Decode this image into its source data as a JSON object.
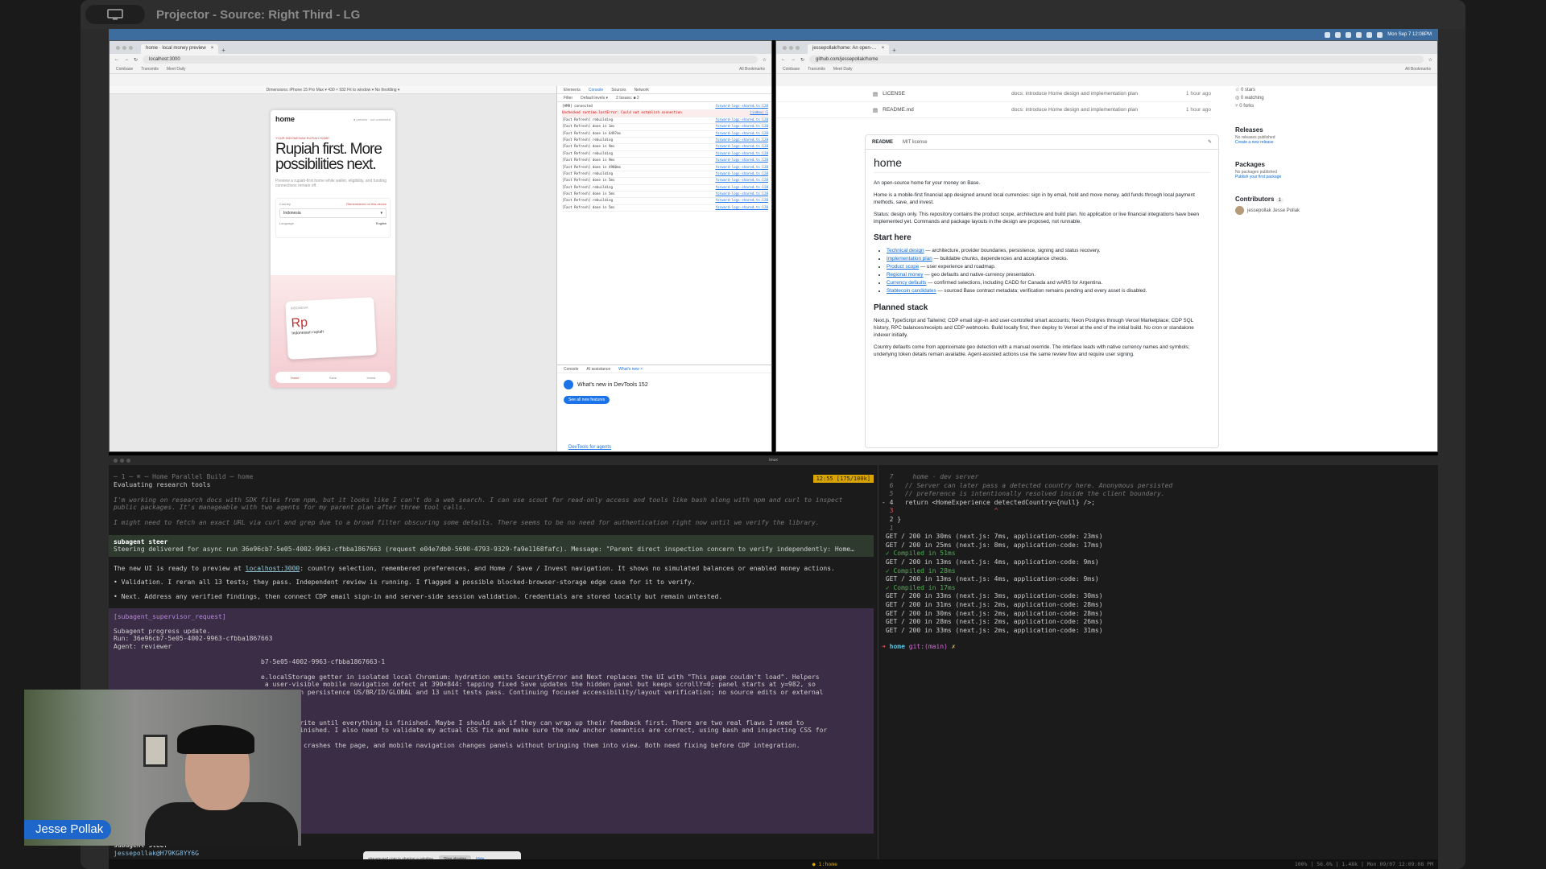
{
  "projector": {
    "title": "Projector - Source: Right Third - LG"
  },
  "menubar": {
    "clock": "Mon Sep 7  12:08PM"
  },
  "left_browser": {
    "tab_title": "home · local money preview",
    "url": "localhost:3000",
    "bookmarks": [
      "Coinbase",
      "Transmits",
      "Meet Daily"
    ],
    "all_bookmarks": "All Bookmarks",
    "device_bar": "Dimensions: iPhone 15 Pro Max  ▾  430  ×  932   Fit to window ▾   No throttling ▾",
    "app": {
      "logo": "home",
      "tagline": "● preview · not connected",
      "kicker": "YOUR INDONESIAN RUPIAH HOME",
      "hero": "Rupiah first. More possibilities next.",
      "sub": "Preview a rupiah-first home while wallet, eligibility, and funding connections remain off.",
      "country_label": "Country",
      "country_hint": "Remembered on this device",
      "country_value": "Indonesia",
      "language_label": "Language",
      "language_value": "English",
      "card_label": "INDONESIA",
      "card_currency": "Rp",
      "card_name": "Indonesian rupiah",
      "nav": [
        "Home",
        "Save",
        "Invest"
      ]
    },
    "devtools": {
      "tabs": [
        "Elements",
        "Console",
        "Sources",
        "Network"
      ],
      "filter": "Filter",
      "levels": "Default levels ▾",
      "issues": "2 Issues: ■ 2",
      "logs": [
        {
          "text": "[HMR] connected",
          "src": "forward-logs-shared.ts:128",
          "err": false
        },
        {
          "text": "Unchecked runtime.lastError: Could not establish connection. Receiving end does not exist.",
          "src": "(index):1",
          "err": true
        },
        {
          "text": "[Fast Refresh] rebuilding",
          "src": "forward-logs-shared.ts:128",
          "err": false
        },
        {
          "text": "[Fast Refresh] done in 1ms",
          "src": "forward-logs-shared.ts:128",
          "err": false
        },
        {
          "text": "[Fast Refresh] done in 6497ms",
          "src": "forward-logs-shared.ts:128",
          "err": false
        },
        {
          "text": "[Fast Refresh] rebuilding",
          "src": "forward-logs-shared.ts:128",
          "err": false
        },
        {
          "text": "[Fast Refresh] done in 9ms",
          "src": "forward-logs-shared.ts:128",
          "err": false
        },
        {
          "text": "[Fast Refresh] rebuilding",
          "src": "forward-logs-shared.ts:128",
          "err": false
        },
        {
          "text": "[Fast Refresh] done in 9ms",
          "src": "forward-logs-shared.ts:128",
          "err": false
        },
        {
          "text": "[Fast Refresh] done in 4980ms",
          "src": "forward-logs-shared.ts:128",
          "err": false
        },
        {
          "text": "[Fast Refresh] rebuilding",
          "src": "forward-logs-shared.ts:128",
          "err": false
        },
        {
          "text": "[Fast Refresh] done in 5ms",
          "src": "forward-logs-shared.ts:128",
          "err": false
        },
        {
          "text": "[Fast Refresh] rebuilding",
          "src": "forward-logs-shared.ts:128",
          "err": false
        },
        {
          "text": "[Fast Refresh] done in 5ms",
          "src": "forward-logs-shared.ts:128",
          "err": false
        },
        {
          "text": "[Fast Refresh] rebuilding",
          "src": "forward-logs-shared.ts:128",
          "err": false
        },
        {
          "text": "[Fast Refresh] done in 5ms",
          "src": "forward-logs-shared.ts:128",
          "err": false
        }
      ],
      "drawer_tabs": [
        "Console",
        "AI assistance",
        "What's new ×"
      ],
      "whats_new": "What's new in DevTools 152",
      "see_all": "See all new features",
      "agents_link": "DevTools for agents"
    }
  },
  "right_browser": {
    "tab_title": "jessepollak/home: An open-…",
    "url": "github.com/jessepollak/home",
    "files": [
      {
        "name": "LICENSE",
        "msg": "docs: introduce Home design and implementation plan",
        "time": "1 hour ago"
      },
      {
        "name": "README.md",
        "msg": "docs: introduce Home design and implementation plan",
        "time": "1 hour ago"
      }
    ],
    "readme_tabs": [
      "README",
      "MIT license"
    ],
    "readme": {
      "title": "home",
      "p1": "An open-source home for your money on Base.",
      "p2": "Home is a mobile-first financial app designed around local currencies: sign in by email, hold and move money, add funds through local payment methods, save, and invest.",
      "p3": "Status: design only. This repository contains the product scope, architecture and build plan. No application or live financial integrations have been implemented yet. Commands and package layouts in the design are proposed, not runnable.",
      "h_start": "Start here",
      "items": [
        {
          "link": "Technical design",
          "rest": " — architecture, provider boundaries, persistence, signing and status recovery."
        },
        {
          "link": "Implementation plan",
          "rest": " — buildable chunks, dependencies and acceptance checks."
        },
        {
          "link": "Product scope",
          "rest": " — user experience and roadmap."
        },
        {
          "link": "Regional money",
          "rest": " — geo defaults and native-currency presentation."
        },
        {
          "link": "Currency defaults",
          "rest": " — confirmed selections, including CADD for Canada and wARS for Argentina."
        },
        {
          "link": "Stablecoin candidates",
          "rest": " — sourced Base contract metadata; verification remains pending and every asset is disabled."
        }
      ],
      "h_stack": "Planned stack",
      "p4": "Next.js, TypeScript and Tailwind; CDP email sign-in and user-controlled smart accounts; Neon Postgres through Vercel Marketplace; CDP SQL history, RPC balances/receipts and CDP webhooks. Build locally first, then deploy to Vercel at the end of the initial build. No cron or standalone indexer initially.",
      "p5": "Country defaults come from approximate geo detection with a manual override. The interface leads with native currency names and symbols; underlying token details remain available. Agent-assisted actions use the same review flow and require user signing."
    },
    "sidebar": {
      "stats": [
        "☆ 0 stars",
        "◎ 0 watching",
        "⑂ 0 forks"
      ],
      "releases": "Releases",
      "releases_sub": "No releases published",
      "releases_link": "Create a new release",
      "packages": "Packages",
      "packages_sub": "No packages published",
      "packages_link": "Publish your first package",
      "contributors": "Contributors",
      "contributors_count": "1",
      "contributor": "jessepollak  Jesse Pollak"
    }
  },
  "terminal": {
    "title": "tmux",
    "left_header": "─ 1 ─ ⌘ ─ Home Parallel Build ─ home",
    "status_pill": "12:55  [175/100k]",
    "left_lines": [
      {
        "text": "Evaluating research tools",
        "cls": ""
      },
      {
        "text": "",
        "cls": ""
      },
      {
        "text": "I'm working on research docs with SDK files from npm, but it looks like I can't do a web search. I can use scout for read-only access and tools like bash along with npm and curl to inspect",
        "cls": "dim"
      },
      {
        "text": "public packages. It's manageable with two agents for my parent plan after three tool calls.",
        "cls": "dim"
      },
      {
        "text": "",
        "cls": ""
      },
      {
        "text": "I might need to fetch an exact URL via curl and grep due to a broad filter obscuring some details. There seems to be no need for authentication right now until we verify the library.",
        "cls": "dim"
      }
    ],
    "steer_label": "subagent steer",
    "steer_text": "Steering delivered for async run 36e96cb7-5e05-4002-9963-cfbba1867663 (request e04e7db0-5690-4793-9329-fa9e1168fafc). Message: \"Parent direct inspection concern to verify independently: Home…",
    "ready_prefix": "The new UI is ready to preview at ",
    "ready_link": "localhost:3000",
    "ready_suffix": ": country selection, remembered preferences, and Home / Save / Invest navigation. It shows no simulated balances or enabled money actions.",
    "validation": "• Validation. I reran all 13 tests; they pass. Independent review is running. I flagged a possible blocked-browser-storage edge case for it to verify.",
    "next": "• Next. Address any verified findings, then connect CDP email sign-in and server-side session validation. Credentials are stored locally but remain untested.",
    "supervisor": {
      "tag": "[subagent_supervisor_request]",
      "lines": [
        "Subagent progress update.",
        "Run: 36e96cb7-5e05-4002-9963-cfbba1867663",
        "Agent: reviewer",
        "",
        "                                      b7-5e05-4002-9963-cfbba1867663-1",
        "",
        "                                      e.localStorage getter in isolated local Chromium: hydration emits SecurityError and Next replaces the UI with \"This page couldn't load\". Helpers",
        "                                       a user-visible mobile navigation defect at 390×844: tapping fixed Save updates the hidden panel but keeps scrollY=0; panel starts at y=982, so",
        "                                      rmal region persistence US/BR/ID/GLOBAL and 13 unit tests pass. Continuing focused accessibility/layout verification; no source edits or external",
        "",
        "",
        "",
        "                                      houldn't write until everything is finished. Maybe I should ask if they can wrap up their feedback first. There are two real flaws I need to",
        "                                      ing half-finished. I also need to validate my actual CSS fix and make sure the new anchor semantics are correct, using bash and inspecting CSS for",
        "",
        "                                      er storage crashes the page, and mobile navigation changes panels without bringing them into view. Both need fixing before CDP integration."
      ]
    },
    "steer2": "subagent steer",
    "prompt_user": "jessepollak@H79KG8YY6G",
    "right_lines": [
      {
        "text": "  7     home · dev server",
        "cls": "dim"
      },
      {
        "text": "  6   // Server can later pass a detected country here. Anonymous persisted",
        "cls": "dim"
      },
      {
        "text": "  5   // preference is intentionally resolved inside the client boundary.",
        "cls": "dim"
      },
      {
        "text": "- 4   return <HomeExperience detectedCountry={null} />;",
        "cls": ""
      },
      {
        "text": "  3                          ^",
        "cls": "red"
      },
      {
        "text": "  2 }",
        "cls": ""
      },
      {
        "text": "  1",
        "cls": "dim"
      },
      {
        "text": " GET / 200 in 30ms (next.js: 7ms, application-code: 23ms)",
        "cls": ""
      },
      {
        "text": " GET / 200 in 25ms (next.js: 8ms, application-code: 17ms)",
        "cls": ""
      },
      {
        "text": " ✓ Compiled in 51ms",
        "cls": "grn"
      },
      {
        "text": " GET / 200 in 13ms (next.js: 4ms, application-code: 9ms)",
        "cls": ""
      },
      {
        "text": " ✓ Compiled in 28ms",
        "cls": "grn"
      },
      {
        "text": " GET / 200 in 13ms (next.js: 4ms, application-code: 9ms)",
        "cls": ""
      },
      {
        "text": " ✓ Compiled in 17ms",
        "cls": "grn"
      },
      {
        "text": " GET / 200 in 33ms (next.js: 3ms, application-code: 30ms)",
        "cls": ""
      },
      {
        "text": " GET / 200 in 31ms (next.js: 2ms, application-code: 28ms)",
        "cls": ""
      },
      {
        "text": " GET / 200 in 30ms (next.js: 2ms, application-code: 28ms)",
        "cls": ""
      },
      {
        "text": " GET / 200 in 28ms (next.js: 2ms, application-code: 26ms)",
        "cls": ""
      },
      {
        "text": " GET / 200 in 33ms (next.js: 2ms, application-code: 31ms)",
        "cls": ""
      }
    ],
    "right_prompt_arrow": "➜",
    "right_prompt_dir": "home",
    "right_prompt_git": "git:(main)",
    "right_prompt_x": "✗",
    "tmux_window": "● 1:home",
    "tmux_right": "100%  |  56.0%  |  1.48k  |  Mon 09/07 12:09:08 PM"
  },
  "share_bar": {
    "text": "streamyard.com is sharing a window.",
    "stop": "Stop sharing",
    "hide": "Hide"
  },
  "webcam": {
    "name": "Jesse Pollak"
  }
}
